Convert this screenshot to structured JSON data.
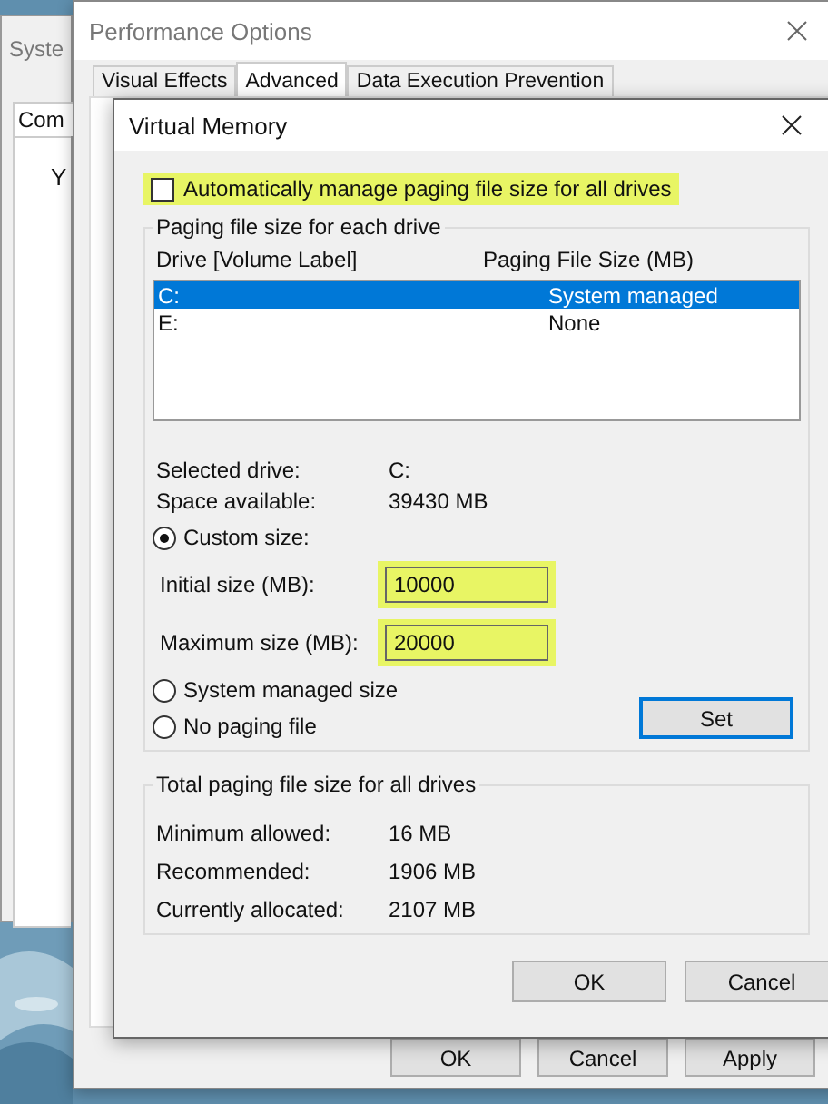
{
  "system_window": {
    "title": "Syste",
    "tab": "Com",
    "heading": "Y"
  },
  "performance_options": {
    "title": "Performance Options",
    "tabs": [
      {
        "label": "Visual Effects",
        "selected": false
      },
      {
        "label": "Advanced",
        "selected": true
      },
      {
        "label": "Data Execution Prevention",
        "selected": false
      }
    ],
    "buttons": [
      "OK",
      "Cancel",
      "Apply"
    ]
  },
  "virtual_memory": {
    "title": "Virtual Memory",
    "auto_manage": {
      "label": "Automatically manage paging file size for all drives",
      "checked": false,
      "highlighted": true
    },
    "drives_group": {
      "title": "Paging file size for each drive",
      "columns": [
        "Drive  [Volume Label]",
        "Paging File Size (MB)"
      ],
      "rows": [
        {
          "drive": "C:",
          "size": "System managed",
          "selected": true
        },
        {
          "drive": "E:",
          "size": "None",
          "selected": false
        }
      ],
      "info": [
        {
          "label": "Selected drive:",
          "value": "C:"
        },
        {
          "label": "Space available:",
          "value": "39430 MB"
        }
      ],
      "custom_size": {
        "label": "Custom size:",
        "selected": true
      },
      "fields": [
        {
          "label": "Initial size (MB):",
          "value": "10000",
          "highlighted": true
        },
        {
          "label": "Maximum size (MB):",
          "value": "20000",
          "highlighted": true
        }
      ],
      "other_options": [
        {
          "label": "System managed size",
          "selected": false
        },
        {
          "label": "No paging file",
          "selected": false
        }
      ],
      "set_button": "Set"
    },
    "totals_group": {
      "title": "Total paging file size for all drives",
      "rows": [
        {
          "label": "Minimum allowed:",
          "value": "16 MB"
        },
        {
          "label": "Recommended:",
          "value": "1906 MB"
        },
        {
          "label": "Currently allocated:",
          "value": "2107 MB"
        }
      ]
    },
    "buttons": [
      "OK",
      "Cancel"
    ]
  }
}
